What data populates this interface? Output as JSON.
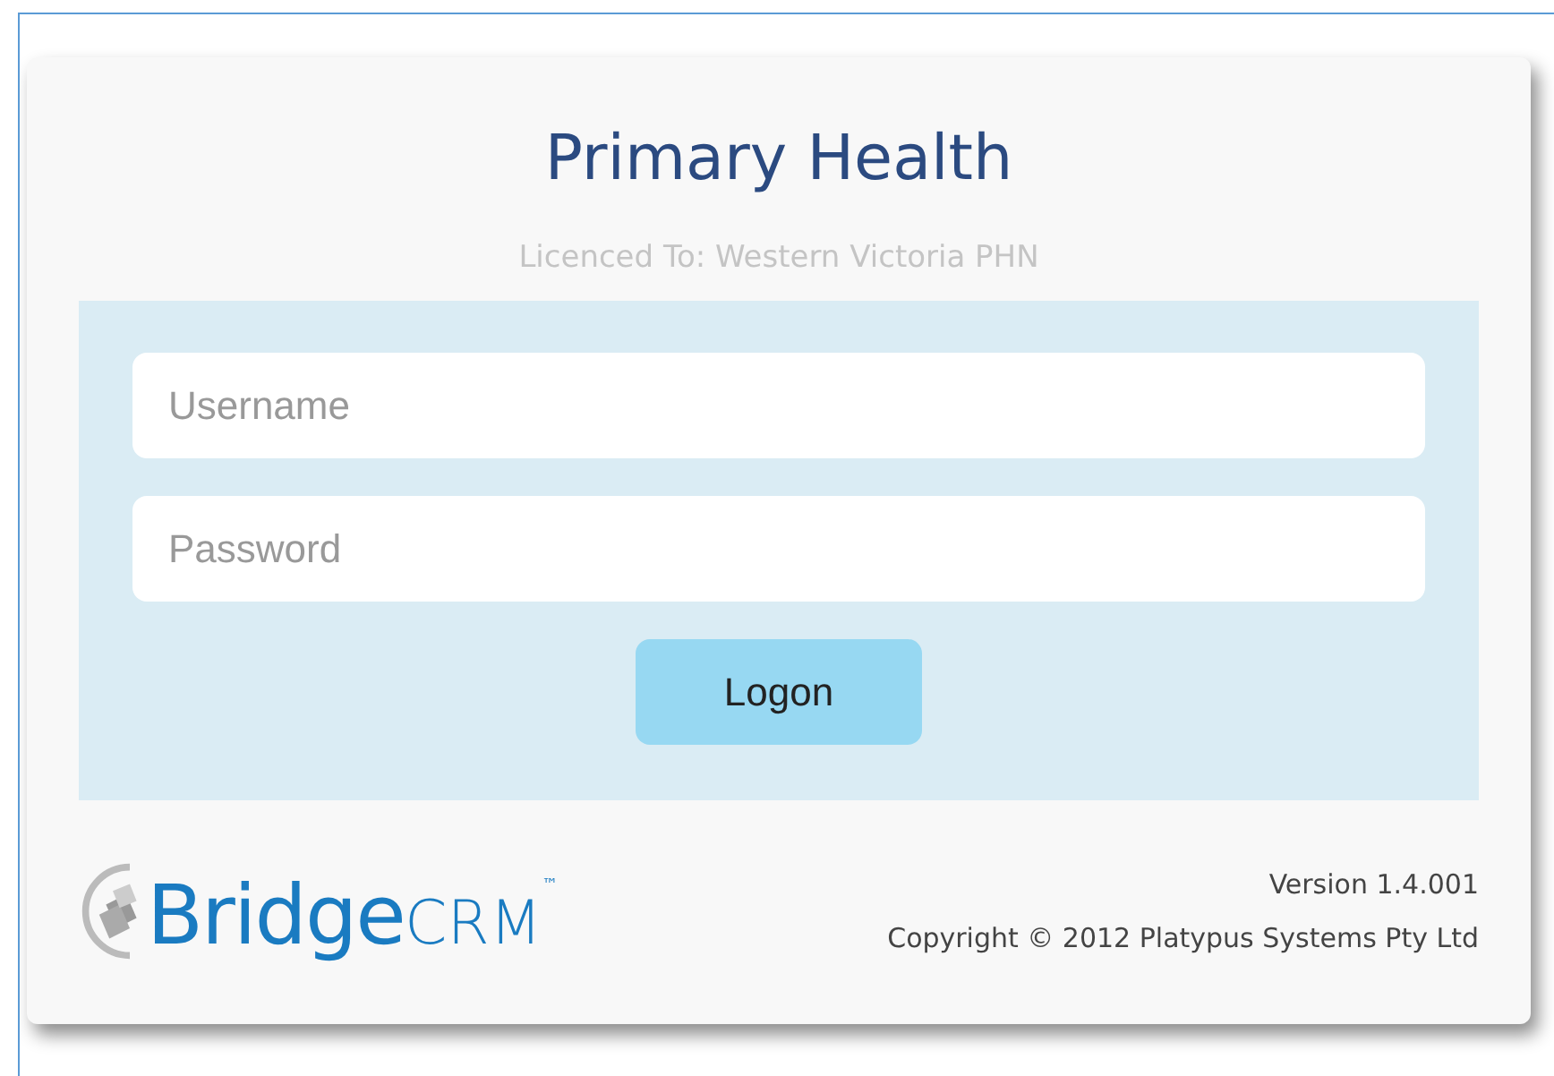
{
  "title": "Primary Health",
  "licence": "Licenced To: Western Victoria PHN",
  "fields": [
    {
      "placeholder": "Username"
    },
    {
      "placeholder": "Password"
    }
  ],
  "button": "Logon",
  "logo": {
    "name": "Bridge",
    "suffix": "CRM",
    "mark": "™"
  },
  "version": "Version 1.4.001",
  "copyright": "Copyright © 2012 Platypus Systems Pty Ltd"
}
